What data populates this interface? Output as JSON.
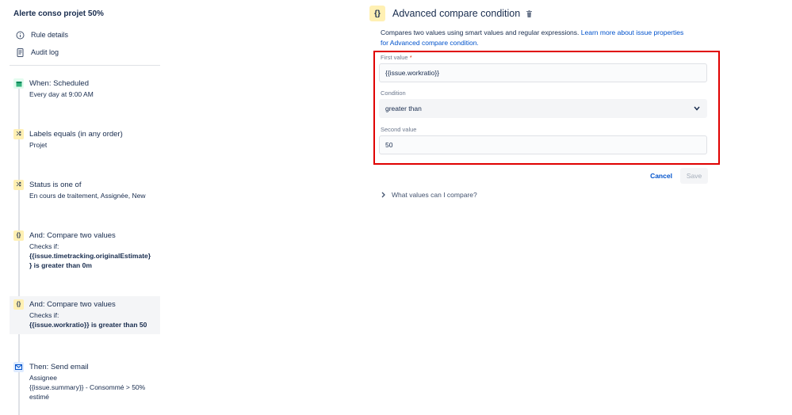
{
  "rule": {
    "title": "Alerte conso projet 50%",
    "nav": [
      {
        "label": "Rule details",
        "icon": "info-icon"
      },
      {
        "label": "Audit log",
        "icon": "document-icon"
      }
    ]
  },
  "steps": [
    {
      "badge": "▦",
      "icon": "calendar-icon",
      "title": "When: Scheduled",
      "lines": [
        "Every day at 9:00 AM"
      ]
    },
    {
      "badge": "⤮",
      "icon": "branch-icon",
      "title": "Labels equals (in any order)",
      "lines": [
        "Projet"
      ]
    },
    {
      "badge": "⤮",
      "icon": "branch-icon",
      "title": "Status is one of",
      "lines": [
        "En cours de traitement, Assignée, New"
      ]
    },
    {
      "badge": "{}",
      "icon": "braces-icon",
      "title": "And: Compare two values",
      "lines": [
        "Checks if:"
      ],
      "bold_lines": [
        "{{issue.timetracking.originalEstimate}",
        "} is greater than 0m"
      ]
    },
    {
      "badge": "{}",
      "icon": "braces-icon",
      "title": "And: Compare two values",
      "lines": [
        "Checks if:"
      ],
      "bold_lines": [
        "{{issue.workratio}} is greater than 50"
      ]
    },
    {
      "badge": "✉",
      "icon": "envelope-icon",
      "title": "Then: Send email",
      "lines": [
        "Assignee",
        "{{issue.summary}} - Consommé > 50%",
        "estimé"
      ]
    }
  ],
  "editor": {
    "badge": "{}",
    "title": "Advanced compare condition",
    "description": "Compares two values using smart values and regular expressions.",
    "link_line1": "Learn more about issue properties",
    "link_line2": "for Advanced compare condition.",
    "first_value_label": "First value",
    "required_mark": "*",
    "first_value": "{{issue.workratio}}",
    "condition_label": "Condition",
    "condition_value": "greater than",
    "second_value_label": "Second value",
    "second_value": "50",
    "cancel_label": "Cancel",
    "save_label": "Save",
    "expander_label": "What values can I compare?"
  },
  "colors": {
    "highlight_border": "#e00000",
    "link": "#0052cc",
    "text": "#172b4d"
  }
}
